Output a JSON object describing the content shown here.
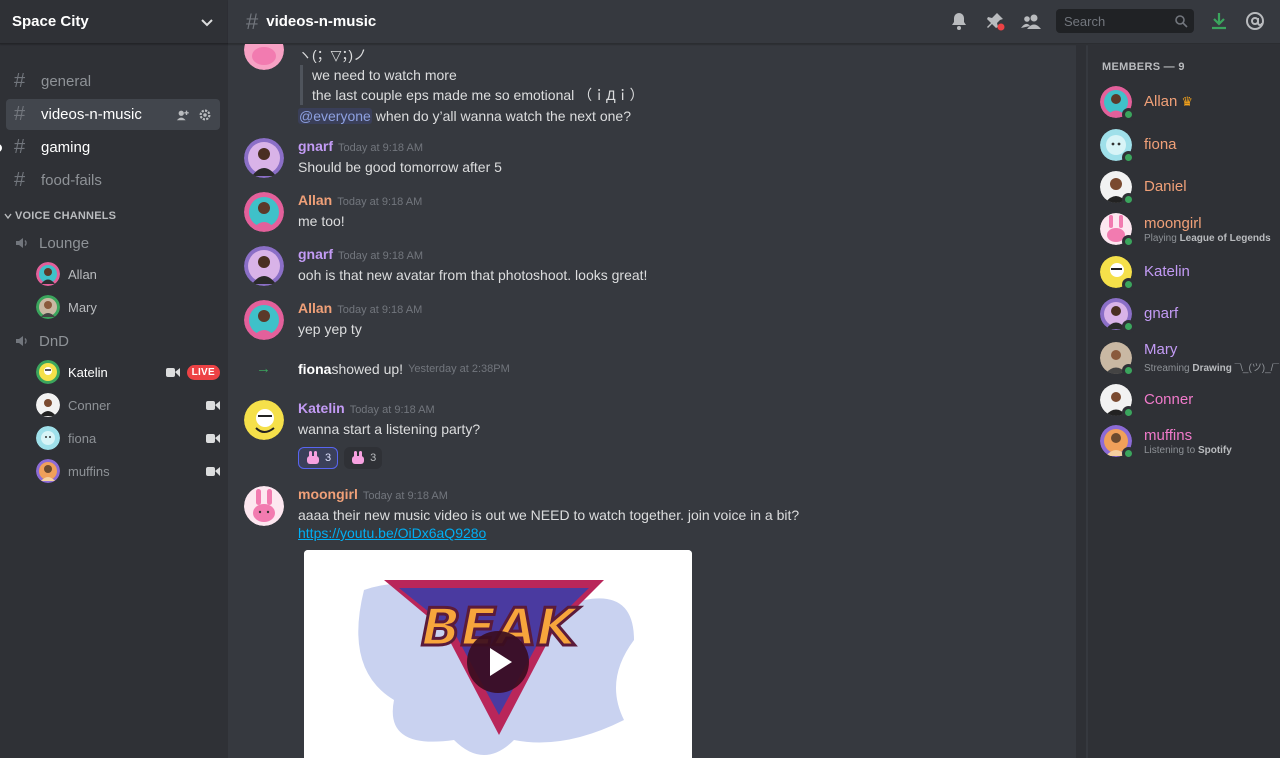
{
  "server": {
    "name": "Space City"
  },
  "channels": [
    {
      "name": "general"
    },
    {
      "name": "videos-n-music"
    },
    {
      "name": "gaming"
    },
    {
      "name": "food-fails"
    }
  ],
  "voice": {
    "category": "VOICE CHANNELS",
    "channels": [
      {
        "name": "Lounge",
        "users": [
          {
            "name": "Allan"
          },
          {
            "name": "Mary"
          }
        ]
      },
      {
        "name": "DnD",
        "users": [
          {
            "name": "Katelin",
            "live": "LIVE"
          },
          {
            "name": "Conner"
          },
          {
            "name": "fiona"
          },
          {
            "name": "muffins"
          }
        ]
      }
    ]
  },
  "header": {
    "channel": "videos-n-music",
    "search_placeholder": "Search"
  },
  "chat": {
    "top": {
      "kaomoji": "ヽ(；▽；)ノ",
      "quote1": "we need to watch more",
      "quote2": "the last couple eps made me so emotional （ｉДｉ）",
      "mention": "@everyone",
      "text": " when do y’all wanna watch the next one?"
    },
    "messages": [
      {
        "author": "gnarf",
        "ts": "Today at 9:18 AM",
        "text": "Should be good tomorrow after 5"
      },
      {
        "author": "Allan",
        "ts": "Today at 9:18 AM",
        "text": "me too!"
      },
      {
        "author": "gnarf",
        "ts": "Today at 9:18 AM",
        "text": "ooh is that new avatar from that photoshoot. looks great!"
      },
      {
        "author": "Allan",
        "ts": "Today at 9:18 AM",
        "text": "yep yep ty"
      },
      {
        "author": "Katelin",
        "ts": "Today at 9:18 AM",
        "text": "wanna start a listening party?"
      },
      {
        "author": "moongirl",
        "ts": "Today at 9:18 AM",
        "text": "aaaa their new music video is out we NEED to watch together. join voice in a bit?",
        "link": "https://youtu.be/OiDx6aQ928o"
      }
    ],
    "join": {
      "user": "fiona",
      "text": " showed up!",
      "ts": "Yesterday at 2:38PM"
    },
    "reactions": [
      {
        "count": "3"
      },
      {
        "count": "3"
      }
    ],
    "embed": {
      "logo": "BEAK"
    }
  },
  "members": {
    "title": "MEMBERS — 9",
    "list": [
      {
        "name": "Allan",
        "color": "#f0a078"
      },
      {
        "name": "fiona",
        "color": "#f0a078"
      },
      {
        "name": "Daniel",
        "color": "#f0a078"
      },
      {
        "name": "moongirl",
        "color": "#f0a078",
        "activity_prefix": "Playing ",
        "activity_strong": "League of Legends"
      },
      {
        "name": "Katelin",
        "color": "#c39bf5"
      },
      {
        "name": "gnarf",
        "color": "#c39bf5"
      },
      {
        "name": "Mary",
        "color": "#c39bf5",
        "activity_prefix": "Streaming ",
        "activity_strong": "Drawing ",
        "activity_suffix": "¯\\_(ツ)_/¯"
      },
      {
        "name": "Conner",
        "color": "#f07aca"
      },
      {
        "name": "muffins",
        "color": "#f07aca",
        "activity_prefix": "Listening to ",
        "activity_strong": "Spotify"
      }
    ]
  },
  "colors": {
    "accent": "#5865f2",
    "online": "#3ba55d",
    "live": "#ed4245",
    "gnarf": "#c39bf5",
    "allan": "#f0a078",
    "katelin": "#c39bf5",
    "moongirl": "#f0a078"
  }
}
